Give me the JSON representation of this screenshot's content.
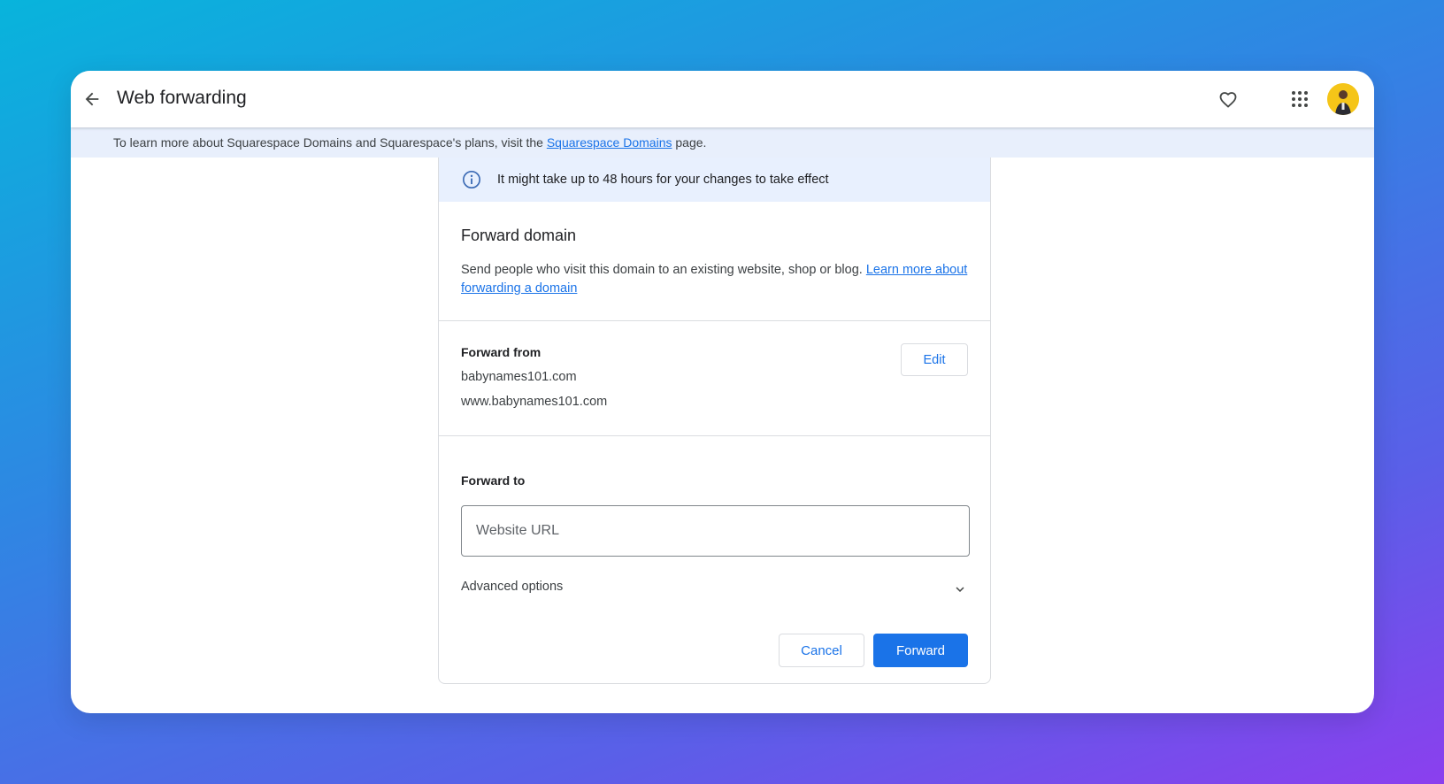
{
  "header": {
    "title": "Web forwarding",
    "icons": {
      "back": "arrow-left-icon",
      "favorite": "heart-icon",
      "apps": "apps-grid-icon",
      "avatar": "user-avatar"
    }
  },
  "banner": {
    "text_before": "To learn more about Squarespace Domains and Squarespace's plans, visit the ",
    "link": "Squarespace Domains",
    "text_after": " page."
  },
  "info": {
    "icon": "info-icon",
    "text": "It might take up to 48 hours for your changes to take effect"
  },
  "forward_domain": {
    "heading": "Forward domain",
    "description": "Send people who visit this domain to an existing website, shop or blog. ",
    "link": "Learn more about forwarding a domain"
  },
  "forward_from": {
    "label": "Forward from",
    "domains": [
      "babynames101.com",
      "www.babynames101.com"
    ],
    "edit_label": "Edit"
  },
  "forward_to": {
    "label": "Forward to",
    "input_value": "",
    "input_placeholder": "Website URL",
    "advanced_label": "Advanced options"
  },
  "actions": {
    "cancel_label": "Cancel",
    "forward_label": "Forward"
  },
  "colors": {
    "accent": "#1a73e8",
    "info_bg": "#e8f0fe",
    "banner_bg": "#e8effc",
    "avatar_bg": "#f5c518"
  }
}
